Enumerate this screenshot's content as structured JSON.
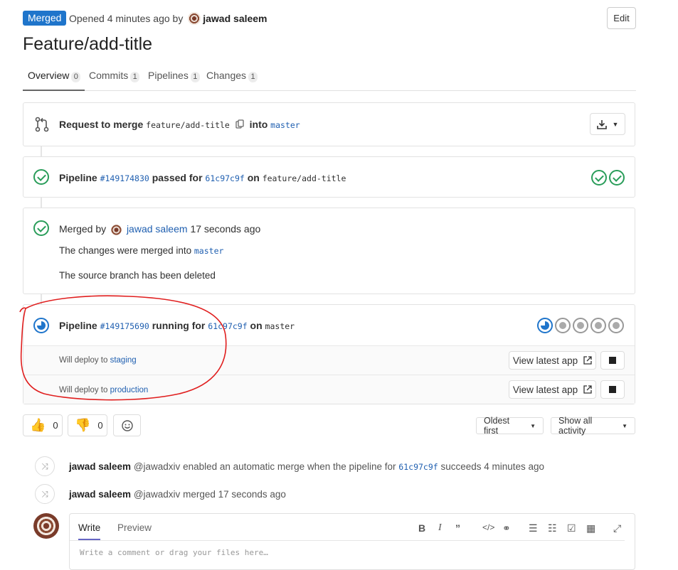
{
  "header": {
    "status": "Merged",
    "opened_text": "Opened 4 minutes ago by",
    "author": "jawad saleem",
    "edit_label": "Edit",
    "title": "Feature/add-title"
  },
  "tabs": [
    {
      "label": "Overview",
      "count": "0"
    },
    {
      "label": "Commits",
      "count": "1"
    },
    {
      "label": "Pipelines",
      "count": "1"
    },
    {
      "label": "Changes",
      "count": "1"
    }
  ],
  "merge_request": {
    "prefix": "Request to merge",
    "source": "feature/add-title",
    "into": "into",
    "target": "master"
  },
  "pipeline1": {
    "label": "Pipeline",
    "id": "#149174830",
    "status": "passed for",
    "commit": "61c97c9f",
    "on": "on",
    "branch": "feature/add-title"
  },
  "merged": {
    "prefix": "Merged by",
    "user": "jawad saleem",
    "time": "17 seconds ago",
    "line1_prefix": "The changes were merged into",
    "line1_branch": "master",
    "line2": "The source branch has been deleted"
  },
  "pipeline2": {
    "label": "Pipeline",
    "id": "#149175690",
    "status": "running for",
    "commit": "61c97c9f",
    "on": "on",
    "branch": "master"
  },
  "deployments": [
    {
      "prefix": "Will deploy to",
      "env": "staging",
      "button": "View latest app"
    },
    {
      "prefix": "Will deploy to",
      "env": "production",
      "button": "View latest app"
    }
  ],
  "reactions": {
    "thumbs_up": "0",
    "thumbs_down": "0"
  },
  "sort": {
    "order": "Oldest first",
    "filter": "Show all activity"
  },
  "notes": [
    {
      "user": "jawad saleem",
      "handle": "@jawadxiv",
      "text_before": "enabled an automatic merge when the pipeline for",
      "commit": "61c97c9f",
      "text_after": "succeeds 4 minutes ago"
    },
    {
      "user": "jawad saleem",
      "handle": "@jawadxiv",
      "text_before": "merged 17 seconds ago"
    }
  ],
  "editor": {
    "tab_write": "Write",
    "tab_preview": "Preview",
    "placeholder": "Write a comment or drag your files here…"
  },
  "colors": {
    "accent": "#1f75cb",
    "success": "#2a9d5a",
    "annotation": "#e01e1e"
  }
}
